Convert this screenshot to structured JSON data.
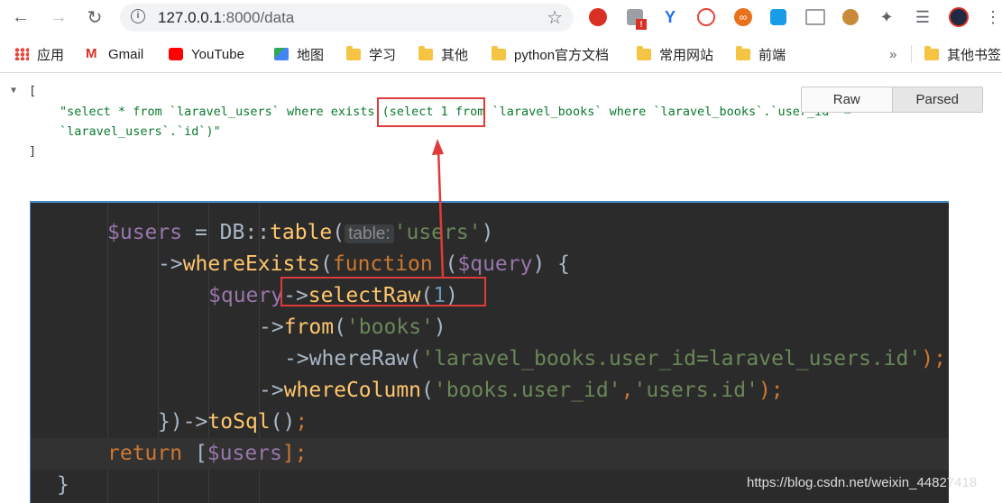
{
  "toolbar": {
    "url_host": "127.0.0.1",
    "url_rest": ":8000/data",
    "icons": [
      "back-icon",
      "forward-icon",
      "reload-icon",
      "info-icon",
      "star-icon"
    ]
  },
  "bookmarks": {
    "apps": "应用",
    "gmail": "Gmail",
    "youtube": "YouTube",
    "map": "地图",
    "study": "学习",
    "other": "其他",
    "python_docs": "python官方文档",
    "common_sites": "常用网站",
    "frontend": "前端",
    "more": "»",
    "other_bookmarks": "其他书签"
  },
  "json_view": {
    "open_bracket": "[",
    "line1": "\"select * from `laravel_users` where exists (select 1 from `laravel_books` where `laravel_books`.`user_id` =",
    "line2": "`laravel_users`.`id`)\"",
    "close_bracket": "]",
    "raw_label": "Raw",
    "parsed_label": "Parsed",
    "active_mode": "Parsed"
  },
  "code": {
    "line1": {
      "var": "$users",
      "eq": " = ",
      "cls": "DB",
      "sep": "::",
      "fn": "table",
      "open": "(",
      "hint": "table:",
      "str": "'users'",
      "close": ")"
    },
    "line2": {
      "arrow": "->",
      "fn": "whereExists",
      "open": "(",
      "kw": "function",
      "space": " (",
      "var": "$query",
      "close": ") {"
    },
    "line3": {
      "var": "$query",
      "arrow": "->",
      "fn": "selectRaw",
      "open": "(",
      "num": "1",
      "close": ")"
    },
    "line4": {
      "arrow": "->",
      "fn": "from",
      "open": "(",
      "str": "'books'",
      "close": ")"
    },
    "line5": {
      "arrow": "->",
      "fn": "whereRaw",
      "open": "(",
      "str": "'laravel_books.user_id=laravel_users.id'",
      "close": ");"
    },
    "line6": {
      "arrow": "->",
      "fn": "whereColumn",
      "open": "(",
      "str1": "'books.user_id'",
      "comma": ",",
      "str2": "'users.id'",
      "close": ");"
    },
    "line7": {
      "close": "})",
      "arrow": "->",
      "fn": "toSql",
      "paren": "()",
      "semi": ";"
    },
    "line8": {
      "kw": "return",
      "space": " [",
      "var": "$users",
      "close": "];"
    },
    "line9": {
      "close": "}"
    }
  },
  "watermark": "https://blog.csdn.net/weixin_44827418",
  "colors": {
    "highlight_box": "#e03a3a",
    "code_bg": "#2b2b2b",
    "json_string": "#0b7a2d"
  }
}
